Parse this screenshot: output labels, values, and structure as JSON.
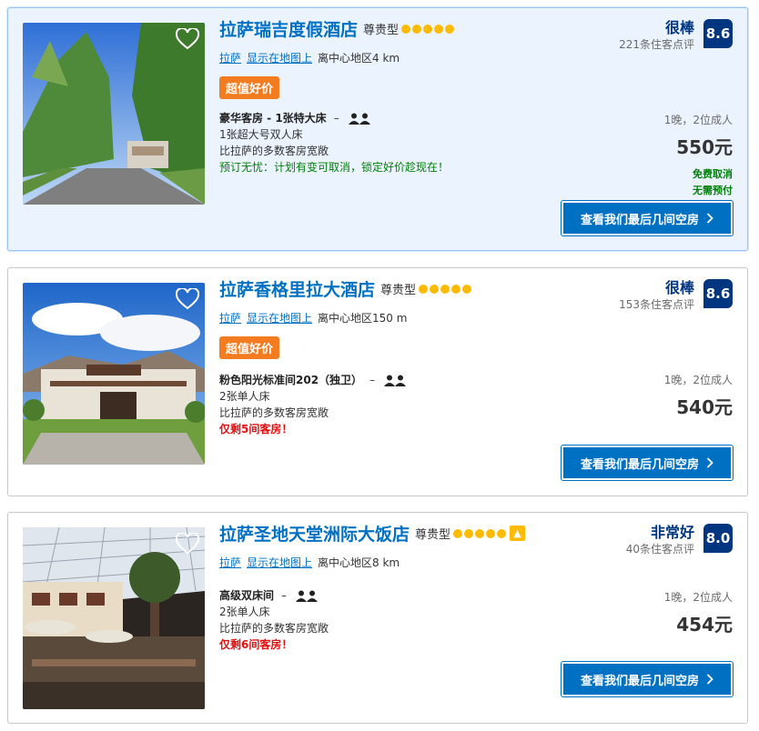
{
  "hotels": [
    {
      "name": "拉萨瑞吉度假酒店",
      "class": "尊贵型",
      "city_link": "拉萨",
      "map_link": "显示在地图上",
      "distance": "离中心地区4 km",
      "deal": "超值好价",
      "room_name": "豪华客房 - 1张特大床",
      "bed": "1张超大号双人床",
      "desc": "比拉萨的多数客房宽敞",
      "note": "预订无忧：计划有变可取消，锁定好价趁现在！",
      "rating_word": "很棒",
      "reviews": "221条住客点评",
      "score": "8.6",
      "nights": "1晚，2位成人",
      "price": "550元",
      "free_cancel": "免费取消",
      "no_prepay": "无需预付",
      "cta": "查看我们最后几间空房"
    },
    {
      "name": "拉萨香格里拉大酒店",
      "class": "尊贵型",
      "city_link": "拉萨",
      "map_link": "显示在地图上",
      "distance": "离中心地区150 m",
      "deal": "超值好价",
      "room_name": "粉色阳光标准间202（独卫）",
      "bed": "2张单人床",
      "desc": "比拉萨的多数客房宽敞",
      "note": "仅剩5间客房！",
      "rating_word": "很棒",
      "reviews": "153条住客点评",
      "score": "8.6",
      "nights": "1晚，2位成人",
      "price": "540元",
      "cta": "查看我们最后几间空房"
    },
    {
      "name": "拉萨圣地天堂洲际大饭店",
      "class": "尊贵型",
      "city_link": "拉萨",
      "map_link": "显示在地图上",
      "distance": "离中心地区8 km",
      "room_name": "高级双床间",
      "bed": "2张单人床",
      "desc": "比拉萨的多数客房宽敞",
      "note": "仅剩6间客房！",
      "rating_word": "非常好",
      "reviews": "40条住客点评",
      "score": "8.0",
      "nights": "1晚，2位成人",
      "price": "454元",
      "cta": "查看我们最后几间空房"
    }
  ],
  "colors": {
    "link": "#0071c2",
    "score_bg": "#003580",
    "deal": "#f47c20",
    "star": "#febb02",
    "green": "#008009",
    "red": "#e21111"
  },
  "icons": [
    "heart-icon",
    "star-icon",
    "persons-icon",
    "chevron-right-icon",
    "thumbs-up-icon"
  ]
}
